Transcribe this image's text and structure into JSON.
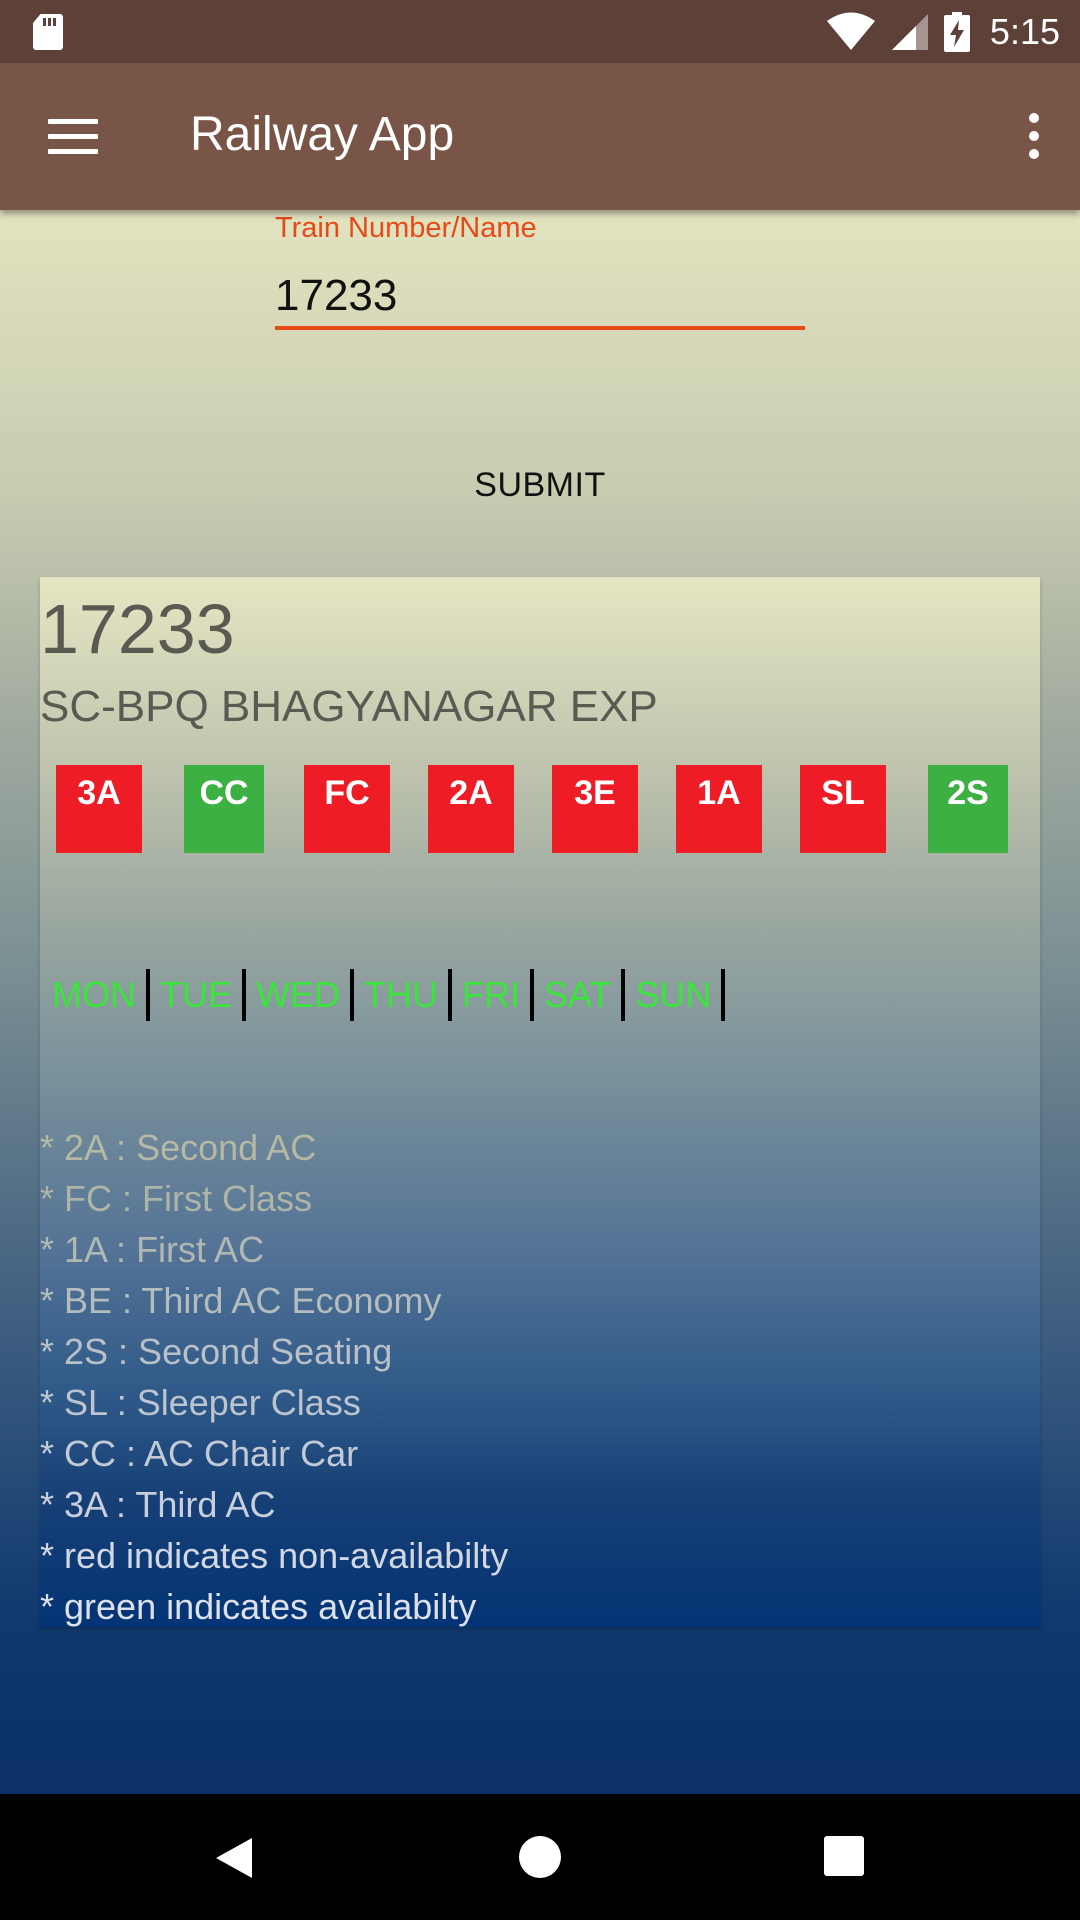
{
  "status_bar": {
    "time": "5:15",
    "icons": [
      "sd-card-icon",
      "wifi-icon",
      "cell-signal-icon",
      "battery-charging-icon"
    ]
  },
  "app_bar": {
    "title": "Railway App",
    "icons": [
      "menu-icon",
      "more-vert-icon"
    ],
    "color": "#795548"
  },
  "form": {
    "label": "Train Number/Name",
    "value": "17233",
    "accent_color": "#e64a19",
    "submit_label": "SUBMIT"
  },
  "result": {
    "train_number": "17233",
    "train_name": "SC-BPQ BHAGYANAGAR EXP",
    "classes": [
      {
        "code": "3A",
        "available": false
      },
      {
        "code": "CC",
        "available": true
      },
      {
        "code": "FC",
        "available": false
      },
      {
        "code": "2A",
        "available": false
      },
      {
        "code": "3E",
        "available": false
      },
      {
        "code": "1A",
        "available": false
      },
      {
        "code": "SL",
        "available": false
      },
      {
        "code": "2S",
        "available": true
      }
    ],
    "days": [
      "MON",
      "TUE",
      "WED",
      "THU",
      "FRI",
      "SAT",
      "SUN"
    ],
    "legend": [
      "* 2A : Second AC",
      "* FC : First Class",
      "* 1A : First AC",
      "* BE : Third AC Economy",
      "* 2S : Second Seating",
      "* SL : Sleeper Class",
      "* CC : AC Chair Car",
      "* 3A : Third AC",
      "* red indicates non-availabilty",
      "* green indicates availabilty"
    ],
    "colors": {
      "unavailable": "#ee1c25",
      "available": "#3cb043",
      "day_running": "#39e639"
    }
  },
  "nav_bar": {
    "icons": [
      "back-icon",
      "home-icon",
      "recents-icon"
    ]
  }
}
